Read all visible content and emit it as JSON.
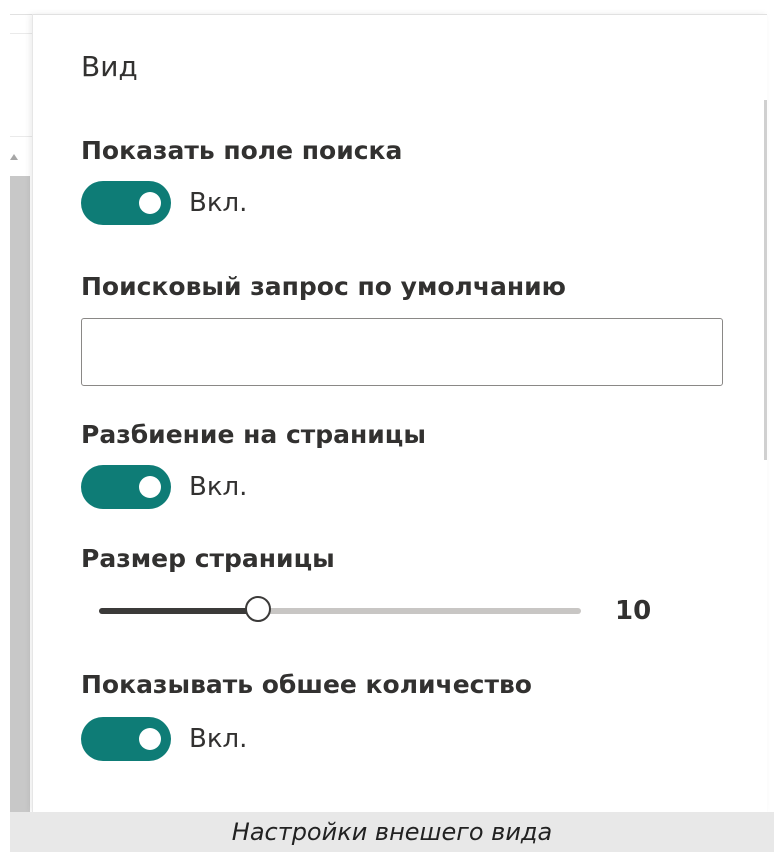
{
  "panel": {
    "title": "Вид"
  },
  "show_search_box": {
    "label": "Показать поле поиска",
    "toggle_on": true,
    "state_text": "Вкл."
  },
  "default_query": {
    "label": "Поисковый запрос по умолчанию",
    "value": "",
    "placeholder": ""
  },
  "paging": {
    "label": "Разбиение на страницы",
    "toggle_on": true,
    "state_text": "Вкл."
  },
  "page_size": {
    "label": "Размер страницы",
    "value": "10",
    "fraction": 0.33
  },
  "show_total": {
    "label": "Показывать обшее количество",
    "toggle_on": true,
    "state_text": "Вкл."
  },
  "colors": {
    "toggle_on": "#0e7c76",
    "text": "#323130"
  },
  "caption": "Настройки внешего вида"
}
